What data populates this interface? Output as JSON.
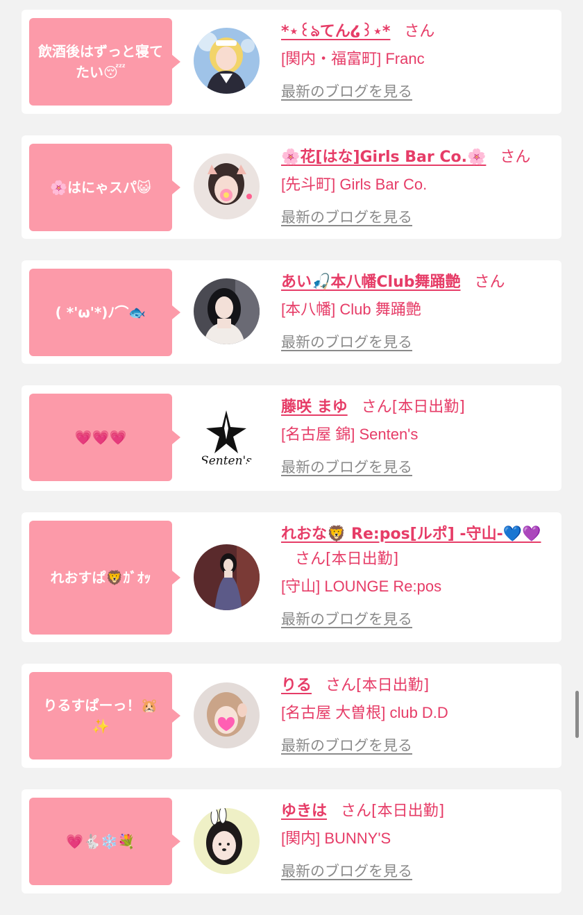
{
  "suffix_san": "さん",
  "blog_link_label": "最新のブログを見る",
  "cards": [
    {
      "bubble": "飲酒後はずっと寝てたい😴",
      "name": "*⋆꒰ঌてん໒꒱⋆*",
      "status": "",
      "shop": "[関内・福富町] Franc",
      "avatar_icon": "avatar-maid-blonde"
    },
    {
      "bubble": "🌸はにゃスパ😺",
      "name": "🌸花[はな]Girls Bar Co.🌸",
      "status": "",
      "shop": "[先斗町] Girls Bar Co.",
      "avatar_icon": "avatar-flower-sticker"
    },
    {
      "bubble": "( *'ω'*)ﾉ⌒🐟",
      "name": "あい🎣本八幡Club舞踊艶",
      "status": "",
      "shop": "[本八幡] Club 舞踊艶",
      "avatar_icon": "avatar-dark-hair"
    },
    {
      "bubble": "💗💗💗",
      "name": "藤咲 まゆ",
      "status": "[本日出勤]",
      "shop": "[名古屋 錦] Senten's",
      "avatar_icon": "avatar-star-logo",
      "logo_text": "Senten's"
    },
    {
      "bubble": "れおすぱ🦁ｶﾞｵｯ",
      "name": "れおな🦁 Re:pos[ルポ] -守山-💙💜",
      "status": "[本日出勤]",
      "shop": "[守山] LOUNGE Re:pos",
      "avatar_icon": "avatar-dress"
    },
    {
      "bubble": "りるすぱーっ！🐹✨",
      "name": "りる",
      "status": "[本日出勤]",
      "shop": "[名古屋 大曽根] club D.D",
      "avatar_icon": "avatar-heart-sticker"
    },
    {
      "bubble": "💗🐇❄️💐",
      "name": "ゆきは",
      "status": "[本日出勤]",
      "shop": "[関内] BUNNY'S",
      "avatar_icon": "avatar-bunny-ears"
    }
  ],
  "colors": {
    "accent": "#e63c67",
    "bubble": "#fc9aa9",
    "muted_link": "#8a8a8a",
    "background": "#f2f2f2"
  }
}
